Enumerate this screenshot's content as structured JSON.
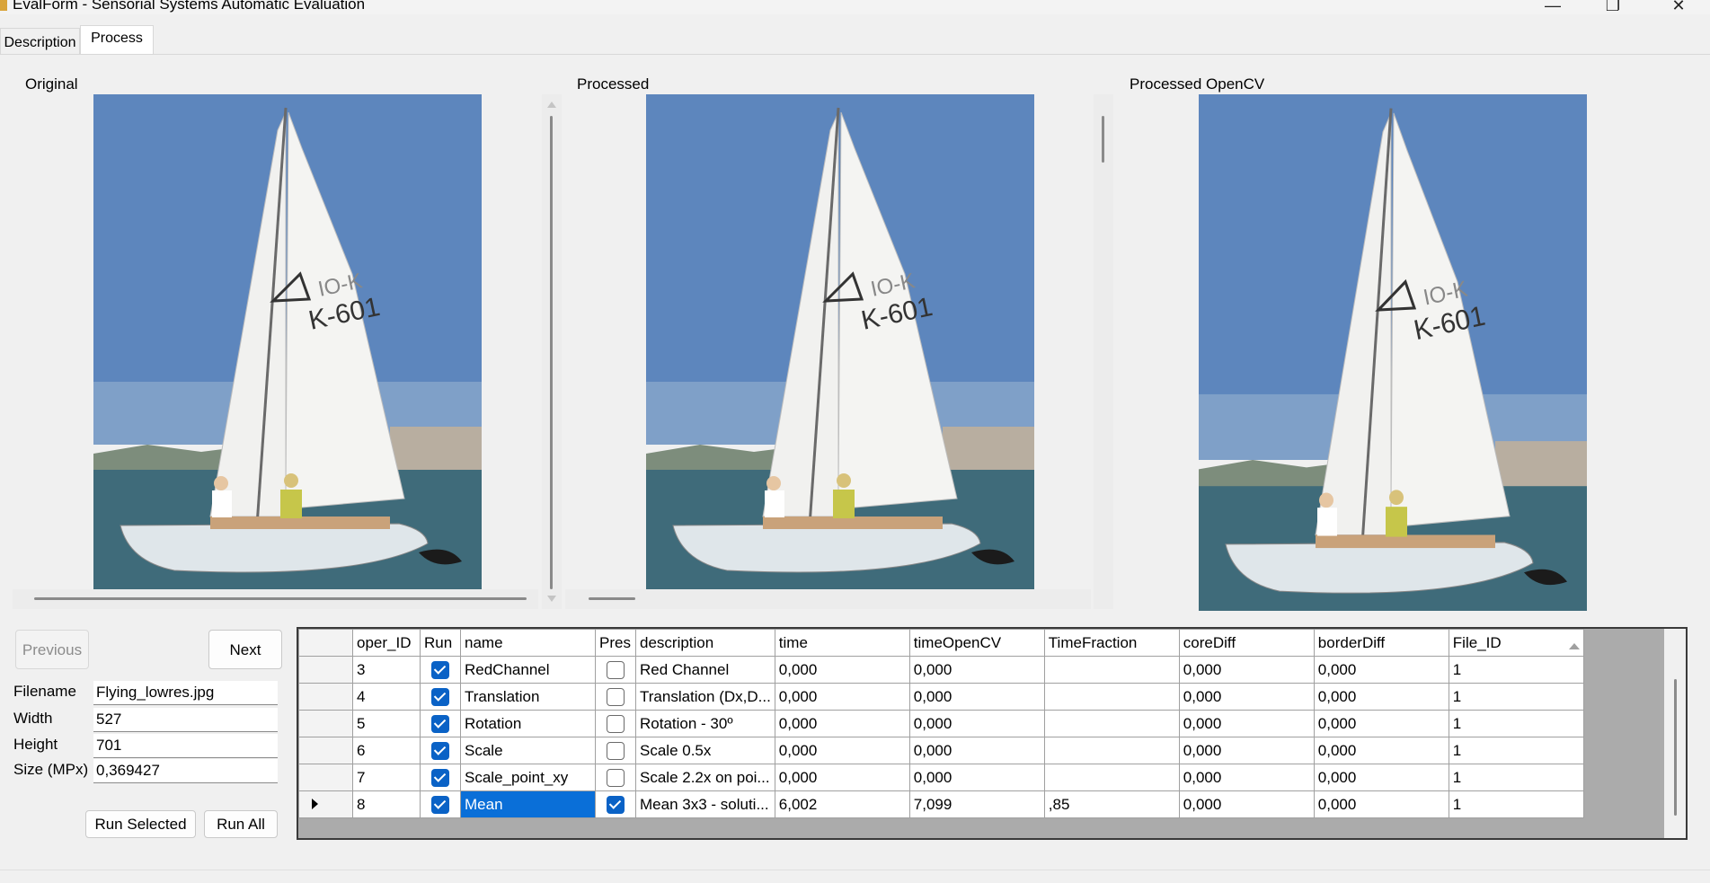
{
  "window": {
    "title": "EvalForm - Sensorial Systems Automatic Evaluation",
    "minimize": "—",
    "maximize": "❐",
    "close": "✕"
  },
  "tabs": [
    {
      "label": "Description",
      "active": false
    },
    {
      "label": "Process",
      "active": true
    }
  ],
  "panels": {
    "original_label": "Original",
    "processed_label": "Processed",
    "opencv_label": "Processed OpenCV",
    "sail_number": "K-601",
    "sail_small": "IO-K"
  },
  "navigation": {
    "previous_label": "Previous",
    "next_label": "Next"
  },
  "file_info": {
    "filename_label": "Filename",
    "filename_value": "Flying_lowres.jpg",
    "width_label": "Width",
    "width_value": "527",
    "height_label": "Height",
    "height_value": "701",
    "size_label": "Size (MPx)",
    "size_value": "0,369427"
  },
  "actions": {
    "run_selected_label": "Run Selected",
    "run_all_label": "Run All"
  },
  "grid": {
    "columns": [
      "oper_ID",
      "Run",
      "name",
      "Pres",
      "description",
      "time",
      "timeOpenCV",
      "TimeFraction",
      "coreDiff",
      "borderDiff",
      "File_ID"
    ],
    "rows": [
      {
        "oper_ID": "3",
        "run": true,
        "name": "RedChannel",
        "pres": false,
        "description": "Red Channel",
        "time": "0,000",
        "timeOpenCV": "0,000",
        "TimeFraction": "",
        "coreDiff": "0,000",
        "borderDiff": "0,000",
        "File_ID": "1"
      },
      {
        "oper_ID": "4",
        "run": true,
        "name": "Translation",
        "pres": false,
        "description": "Translation (Dx,D...",
        "time": "0,000",
        "timeOpenCV": "0,000",
        "TimeFraction": "",
        "coreDiff": "0,000",
        "borderDiff": "0,000",
        "File_ID": "1"
      },
      {
        "oper_ID": "5",
        "run": true,
        "name": "Rotation",
        "pres": false,
        "description": "Rotation - 30º",
        "time": "0,000",
        "timeOpenCV": "0,000",
        "TimeFraction": "",
        "coreDiff": "0,000",
        "borderDiff": "0,000",
        "File_ID": "1"
      },
      {
        "oper_ID": "6",
        "run": true,
        "name": "Scale",
        "pres": false,
        "description": "Scale 0.5x",
        "time": "0,000",
        "timeOpenCV": "0,000",
        "TimeFraction": "",
        "coreDiff": "0,000",
        "borderDiff": "0,000",
        "File_ID": "1"
      },
      {
        "oper_ID": "7",
        "run": true,
        "name": "Scale_point_xy",
        "pres": false,
        "description": "Scale 2.2x on poi...",
        "time": "0,000",
        "timeOpenCV": "0,000",
        "TimeFraction": "",
        "coreDiff": "0,000",
        "borderDiff": "0,000",
        "File_ID": "1"
      },
      {
        "oper_ID": "8",
        "run": true,
        "name": "Mean",
        "pres": true,
        "description": "Mean 3x3 - soluti...",
        "time": "6,002",
        "timeOpenCV": "7,099",
        "TimeFraction": ",85",
        "coreDiff": "0,000",
        "borderDiff": "0,000",
        "File_ID": "1",
        "current": true
      }
    ]
  },
  "colors": {
    "selection": "#0a6fd8",
    "checkbox": "#0a62c6",
    "sky": "#5d86bd",
    "sea": "#3f6b7a"
  }
}
